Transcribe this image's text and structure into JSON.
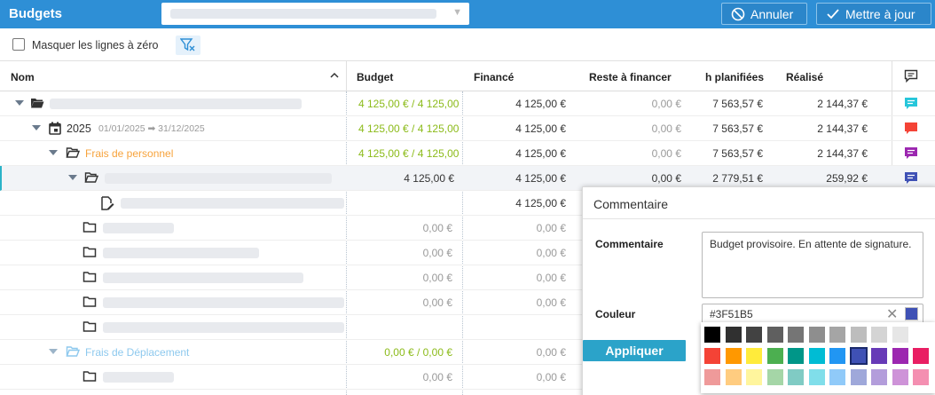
{
  "topbar": {
    "title": "Budgets",
    "cancel_label": "Annuler",
    "update_label": "Mettre à jour"
  },
  "toolbar": {
    "hide_zero_label": "Masquer les lignes à zéro"
  },
  "columns": {
    "name": "Nom",
    "budget": "Budget",
    "financed": "Financé",
    "remaining": "Reste à financer",
    "hours": "h planifiées",
    "realized": "Réalisé"
  },
  "rows": [
    {
      "year": "",
      "dates": "",
      "label": "",
      "budget": "4 125,00 € / 4 125,00",
      "financed": "4 125,00 €",
      "remaining": "0,00 €",
      "hours": "7 563,57 €",
      "realized": "2 144,37 €",
      "comment_color": "#26c6da"
    },
    {
      "year": "2025",
      "dates": "01/01/2025 ➡ 31/12/2025",
      "label": "",
      "budget": "4 125,00 € / 4 125,00",
      "financed": "4 125,00 €",
      "remaining": "0,00 €",
      "hours": "7 563,57 €",
      "realized": "2 144,37 €",
      "comment_color": "#f44336"
    },
    {
      "year": "",
      "dates": "",
      "label": "Frais de personnel",
      "budget": "4 125,00 € / 4 125,00",
      "financed": "4 125,00 €",
      "remaining": "0,00 €",
      "hours": "7 563,57 €",
      "realized": "2 144,37 €",
      "comment_color": "#9c27b0"
    },
    {
      "year": "",
      "dates": "",
      "label": "",
      "budget": "4 125,00 €",
      "financed": "4 125,00 €",
      "remaining": "0,00 €",
      "hours": "2 779,51 €",
      "realized": "259,92 €",
      "comment_color": "#3f51b5"
    },
    {
      "year": "",
      "dates": "",
      "label": "",
      "budget": "",
      "financed": "4 125,00 €",
      "remaining": "",
      "hours": "",
      "realized": "",
      "comment_color": ""
    },
    {
      "year": "",
      "dates": "",
      "label": "",
      "budget": "0,00 €",
      "financed": "0,00 €",
      "remaining": "",
      "hours": "",
      "realized": "",
      "comment_color": ""
    },
    {
      "year": "",
      "dates": "",
      "label": "",
      "budget": "0,00 €",
      "financed": "0,00 €",
      "remaining": "",
      "hours": "",
      "realized": "",
      "comment_color": ""
    },
    {
      "year": "",
      "dates": "",
      "label": "",
      "budget": "0,00 €",
      "financed": "0,00 €",
      "remaining": "",
      "hours": "",
      "realized": "",
      "comment_color": ""
    },
    {
      "year": "",
      "dates": "",
      "label": "",
      "budget": "0,00 €",
      "financed": "0,00 €",
      "remaining": "",
      "hours": "",
      "realized": "",
      "comment_color": ""
    },
    {
      "year": "",
      "dates": "",
      "label": "Frais de Déplacement",
      "budget": "0,00 € / 0,00 €",
      "financed": "0,00 €",
      "remaining": "",
      "hours": "",
      "realized": "",
      "comment_color": ""
    },
    {
      "year": "",
      "dates": "",
      "label": "",
      "budget": "0,00 €",
      "financed": "0,00 €",
      "remaining": "",
      "hours": "",
      "realized": "",
      "comment_color": ""
    }
  ],
  "comment_popup": {
    "title": "Commentaire",
    "comment_label": "Commentaire",
    "comment_text": "Budget provisoire. En attente de signature.",
    "color_label": "Couleur",
    "color_value": "#3F51B5",
    "apply_label": "Appliquer",
    "selected_color": "#3f51b5"
  },
  "palette": [
    [
      "#000000",
      "#303030",
      "#424242",
      "#5f5f5f",
      "#757575",
      "#8e8e8e",
      "#a5a5a5",
      "#bdbdbd",
      "#d4d4d4",
      "#e6e6e6"
    ],
    [
      "#f44336",
      "#ff9800",
      "#ffeb3b",
      "#4caf50",
      "#009688",
      "#00bcd4",
      "#2196f3",
      "#3f51b5",
      "#673ab7",
      "#9c27b0",
      "#e91e63"
    ],
    [
      "#ef9a9a",
      "#ffcc80",
      "#fff59d",
      "#a5d6a7",
      "#80cbc4",
      "#80deea",
      "#90caf9",
      "#9fa8da",
      "#b39ddb",
      "#ce93d8",
      "#f48fb1"
    ]
  ]
}
